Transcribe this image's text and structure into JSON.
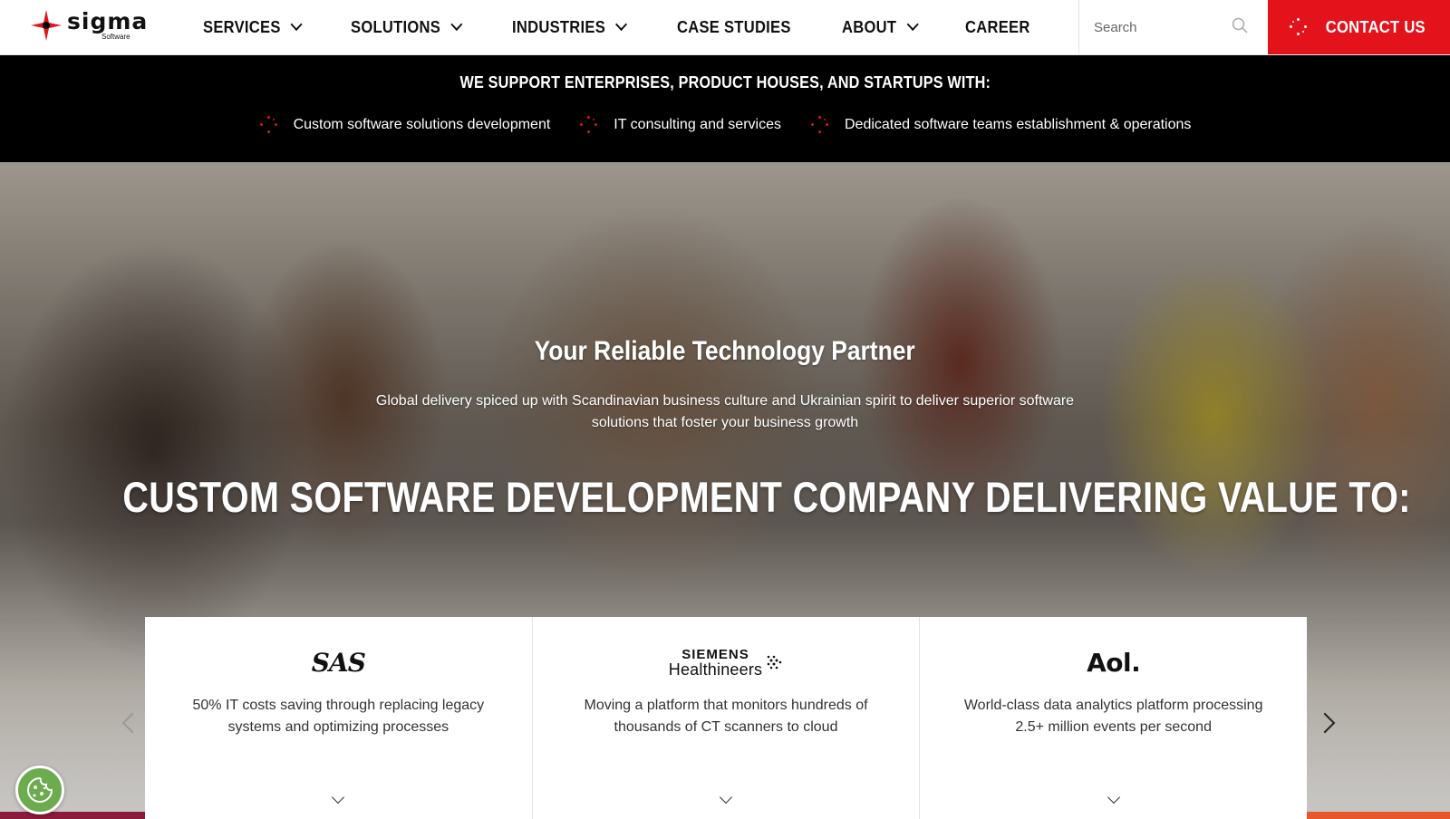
{
  "header": {
    "logo_word": "sigma",
    "logo_sub": "Software",
    "nav": [
      {
        "label": "SERVICES",
        "has_dropdown": true
      },
      {
        "label": "SOLUTIONS",
        "has_dropdown": true
      },
      {
        "label": "INDUSTRIES",
        "has_dropdown": true
      },
      {
        "label": "CASE STUDIES",
        "has_dropdown": false
      },
      {
        "label": "ABOUT",
        "has_dropdown": true
      },
      {
        "label": "CAREER",
        "has_dropdown": false
      }
    ],
    "search_placeholder": "Search",
    "contact_label": "CONTACT US"
  },
  "banner": {
    "title": "WE SUPPORT ENTERPRISES, PRODUCT HOUSES, AND STARTUPS WITH:",
    "items": [
      "Custom software solutions development",
      "IT consulting and services",
      "Dedicated software teams establishment & operations"
    ]
  },
  "hero": {
    "title": "Your Reliable Technology Partner",
    "subtitle": "Global delivery spiced up with Scandinavian business culture and Ukrainian spirit to deliver superior software solutions that foster your business growth",
    "headline": "CUSTOM SOFTWARE DEVELOPMENT COMPANY DELIVERING VALUE TO:"
  },
  "cards": [
    {
      "logo": "SAS",
      "text": "50% IT costs saving through replacing legacy systems and optimizing processes"
    },
    {
      "logo_line1": "SIEMENS",
      "logo_line2": "Healthineers",
      "text": "Moving a platform that monitors hundreds of thousands of CT scanners to cloud"
    },
    {
      "logo": "Aol.",
      "text": "World-class data analytics platform processing 2.5+ million events per second"
    }
  ],
  "colors": {
    "brand_red": "#e3121b",
    "banner_bg": "#000000",
    "cookie_green": "#6cab4e",
    "bar_left": "#8a1b3a",
    "bar_right": "#e8572a"
  },
  "icons": [
    "sigma-logo-icon",
    "chevron-down-icon",
    "search-icon",
    "sparkle-dots-icon",
    "cookie-icon",
    "arrow-left-icon",
    "arrow-right-icon"
  ]
}
